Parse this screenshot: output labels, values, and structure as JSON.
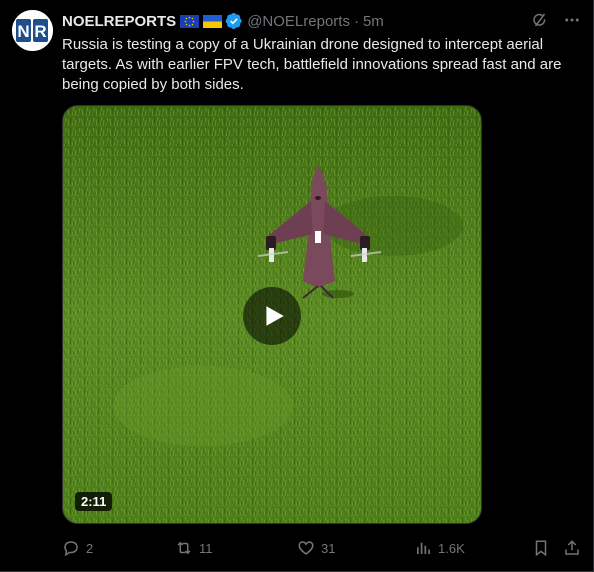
{
  "tweet": {
    "author_name": "NOELREPORTS",
    "handle": "@NOELreports",
    "separator": "·",
    "timestamp": "5m",
    "text": "Russia is testing a copy of a Ukrainian drone designed to intercept aerial targets. As with earlier FPV tech, battlefield innovations spread fast and are being copied by both sides.",
    "avatar_text": "NR"
  },
  "media": {
    "type": "video",
    "duration": "2:11"
  },
  "actions": {
    "replies": "2",
    "retweets": "11",
    "likes": "31",
    "views": "1.6K"
  },
  "colors": {
    "background": "#000000",
    "text": "#e7e9ea",
    "muted": "#71767b",
    "verified": "#1d9bf0",
    "grass": "#4b7a1a",
    "drone": "#7a4a5c"
  },
  "icons": {
    "eu_flag": "eu-flag-icon",
    "ua_flag": "ukraine-flag-icon",
    "verified": "verified-badge-icon",
    "grok": "grok-icon",
    "more": "more-icon",
    "reply": "reply-icon",
    "retweet": "retweet-icon",
    "like": "heart-icon",
    "views": "views-icon",
    "bookmark": "bookmark-icon",
    "share": "share-icon",
    "play": "play-icon"
  }
}
